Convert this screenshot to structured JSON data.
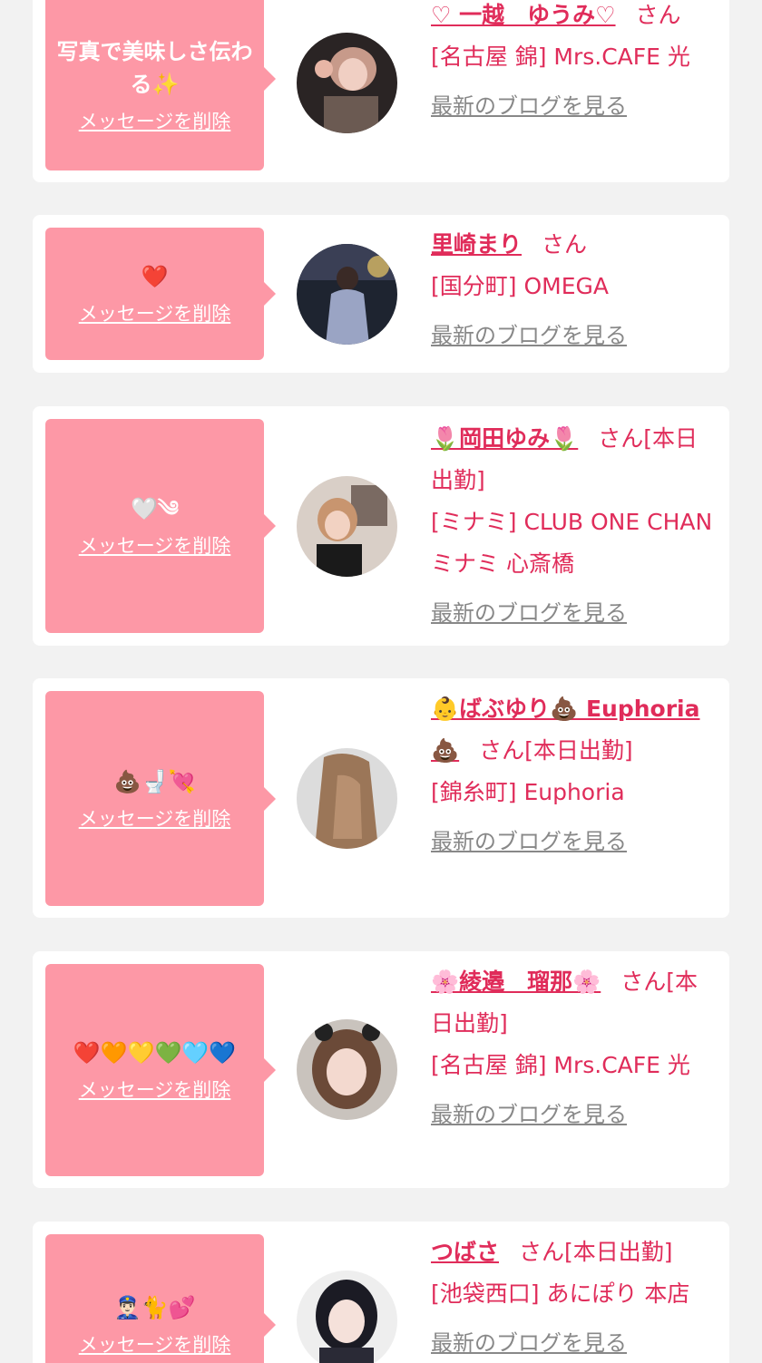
{
  "common": {
    "delete_label": "メッセージを削除",
    "blog_label": "最新のブログを見る",
    "honorific": "さん"
  },
  "cards": [
    {
      "message": "写真で美味しさ伝わる✨",
      "name": "♡ 一越　ゆうみ♡",
      "status": "",
      "shop": "[名古屋 錦] Mrs.CAFE 光",
      "avatar_icon": "avatar-photo"
    },
    {
      "message": "❤️",
      "name": "里崎まり",
      "status": "",
      "shop": "[国分町] OMEGA",
      "avatar_icon": "avatar-photo"
    },
    {
      "message": "🤍༄",
      "name": "🌷岡田ゆみ🌷",
      "status": "[本日出勤]",
      "shop": "[ミナミ] CLUB ONE CHAN ミナミ 心斎橋",
      "avatar_icon": "avatar-photo"
    },
    {
      "message": "💩🚽💘",
      "name": "👶ばぶゆり💩 Euphoria💩",
      "status": "[本日出勤]",
      "shop": "[錦糸町] Euphoria",
      "avatar_icon": "avatar-photo"
    },
    {
      "message": "❤️🧡💛💚🩵💙",
      "name": "🌸綾邉　瑠那🌸",
      "status": "[本日出勤]",
      "shop": "[名古屋 錦] Mrs.CAFE 光",
      "avatar_icon": "avatar-photo"
    },
    {
      "message": "👮🏻‍♂️🐈💕",
      "name": "つばさ",
      "status": "[本日出勤]",
      "shop": "[池袋西口] あにぽり 本店",
      "avatar_icon": "avatar-photo"
    }
  ],
  "colors": {
    "background": "#f2f2f2",
    "card": "#ffffff",
    "bubble": "#fd98a6",
    "accent_text": "#e02c5a",
    "link_gray": "#888888"
  }
}
